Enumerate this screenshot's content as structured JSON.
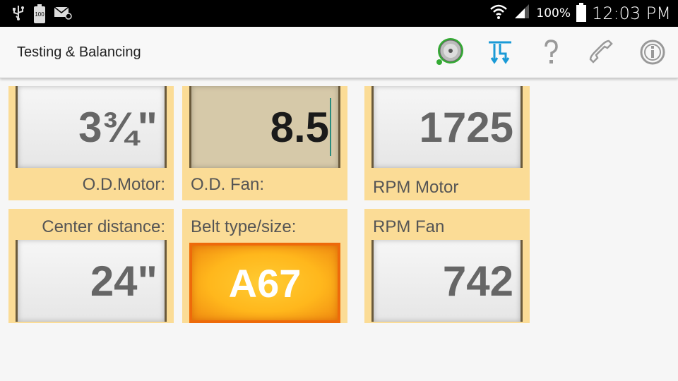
{
  "statusbar": {
    "battery_small_label": "100",
    "battery_percent": "100%",
    "time": "12:03 PM"
  },
  "actionbar": {
    "title": "Testing & Balancing",
    "icons": [
      "disc-icon",
      "transfer-icon",
      "help-icon",
      "phone-icon",
      "info-icon"
    ]
  },
  "tiles": {
    "od_motor": {
      "label": "O.D.Motor:",
      "value": "3¾\""
    },
    "od_fan": {
      "label": "O.D. Fan:",
      "value": "8.5"
    },
    "rpm_motor": {
      "label": "RPM Motor",
      "value": "1725"
    },
    "center_distance": {
      "label": "Center distance:",
      "value": "24\""
    },
    "belt": {
      "label": "Belt type/size:",
      "value": "A67"
    },
    "rpm_fan": {
      "label": "RPM Fan",
      "value": "742"
    }
  },
  "colors": {
    "tile_bg": "#fbdc96",
    "active_field": "#d6c9a9",
    "result_orange": "#ffb71c",
    "accent_blue": "#1a9ad6"
  }
}
